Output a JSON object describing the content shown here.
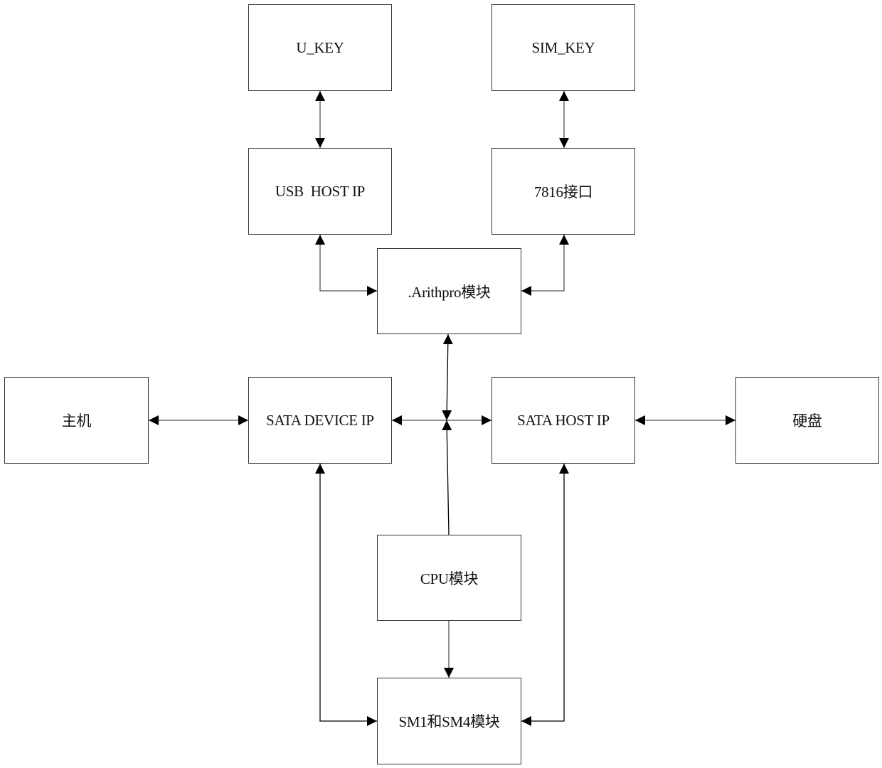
{
  "diagram": {
    "nodes": {
      "u_key": "U_KEY",
      "sim_key": "SIM_KEY",
      "usb_host_ip": "USB  HOST IP",
      "iface_7816": "7816接口",
      "arithpro": ".Arithpro模块",
      "host": "主机",
      "sata_device_ip": "SATA DEVICE IP",
      "sata_host_ip": "SATA HOST IP",
      "hard_disk": "硬盘",
      "cpu": "CPU模块",
      "sm1_sm4": "SM1和SM4模块"
    },
    "edges": [
      {
        "from": "u_key",
        "to": "usb_host_ip",
        "direction": "bidirectional"
      },
      {
        "from": "sim_key",
        "to": "iface_7816",
        "direction": "bidirectional"
      },
      {
        "from": "usb_host_ip",
        "to": "arithpro",
        "direction": "bidirectional"
      },
      {
        "from": "iface_7816",
        "to": "arithpro",
        "direction": "bidirectional"
      },
      {
        "from": "host",
        "to": "sata_device_ip",
        "direction": "bidirectional"
      },
      {
        "from": "sata_device_ip",
        "to": "sata_host_ip",
        "direction": "bidirectional"
      },
      {
        "from": "sata_host_ip",
        "to": "hard_disk",
        "direction": "bidirectional"
      },
      {
        "from": "arithpro",
        "to": "sata_bus_junction",
        "direction": "bidirectional"
      },
      {
        "from": "cpu",
        "to": "sata_bus_junction",
        "direction": "forward"
      },
      {
        "from": "cpu",
        "to": "sm1_sm4",
        "direction": "forward"
      },
      {
        "from": "sata_device_ip",
        "to": "sm1_sm4",
        "direction": "bidirectional"
      },
      {
        "from": "sata_host_ip",
        "to": "sm1_sm4",
        "direction": "bidirectional"
      }
    ]
  }
}
